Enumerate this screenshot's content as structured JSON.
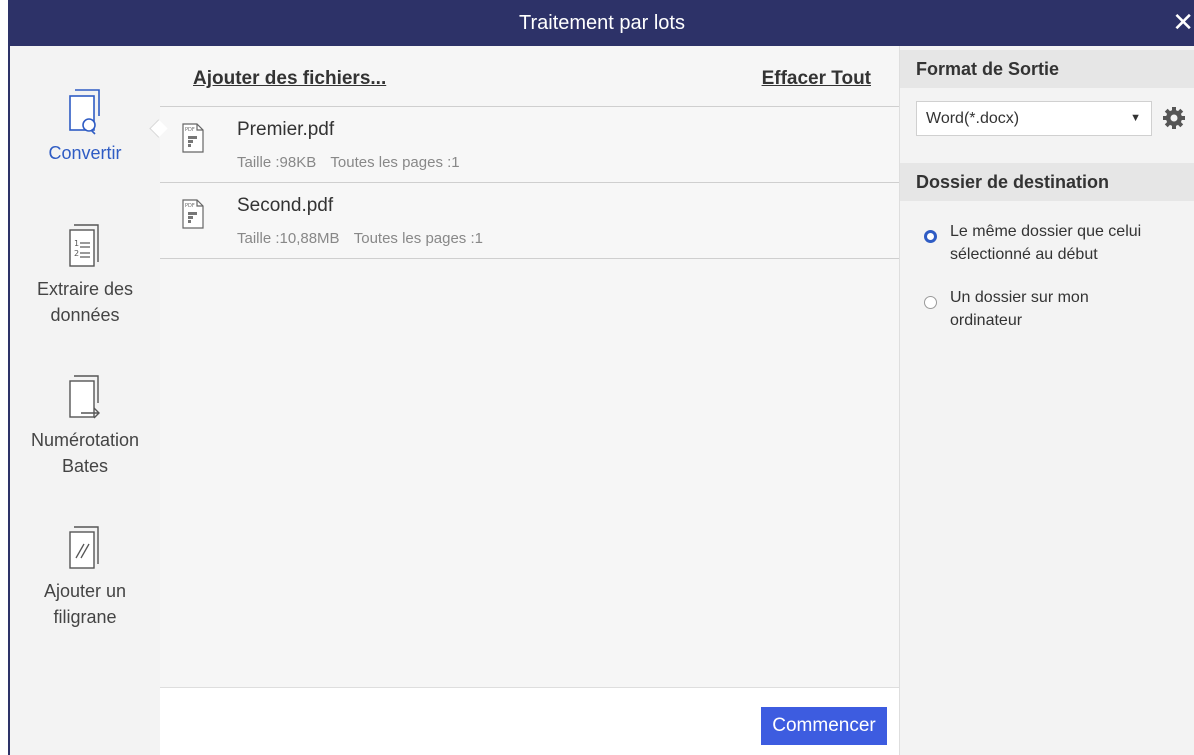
{
  "window": {
    "title": "Traitement par lots",
    "close_glyph": "✕"
  },
  "sidebar": {
    "items": [
      {
        "label_lines": [
          "Convertir"
        ],
        "icon": "convert-icon",
        "active": true
      },
      {
        "label_lines": [
          "Extraire des",
          "données"
        ],
        "icon": "extract-data-icon",
        "active": false
      },
      {
        "label_lines": [
          "Numérotation",
          "Bates"
        ],
        "icon": "bates-numbering-icon",
        "active": false
      },
      {
        "label_lines": [
          "Ajouter un",
          "filigrane"
        ],
        "icon": "watermark-icon",
        "active": false
      }
    ]
  },
  "files": {
    "add_label": "Ajouter des fichiers...",
    "clear_label": "Effacer Tout",
    "list": [
      {
        "name": "Premier.pdf",
        "size": "Taille :98KB",
        "pages": "Toutes les pages :1"
      },
      {
        "name": "Second.pdf",
        "size": "Taille :10,88MB",
        "pages": "Toutes les pages :1"
      }
    ]
  },
  "footer": {
    "start_label": "Commencer"
  },
  "output": {
    "format_heading": "Format de Sortie",
    "format_value": "Word(*.docx)",
    "destination_heading": "Dossier de destination",
    "options": [
      {
        "label_lines": [
          "Le même dossier que celui",
          "sélectionné au début"
        ],
        "selected": true
      },
      {
        "label_lines": [
          "Un dossier sur mon",
          "ordinateur"
        ],
        "selected": false
      }
    ]
  },
  "colors": {
    "titlebar": "#2d3268",
    "accent": "#2f5cc4",
    "button": "#3d5ce0"
  }
}
